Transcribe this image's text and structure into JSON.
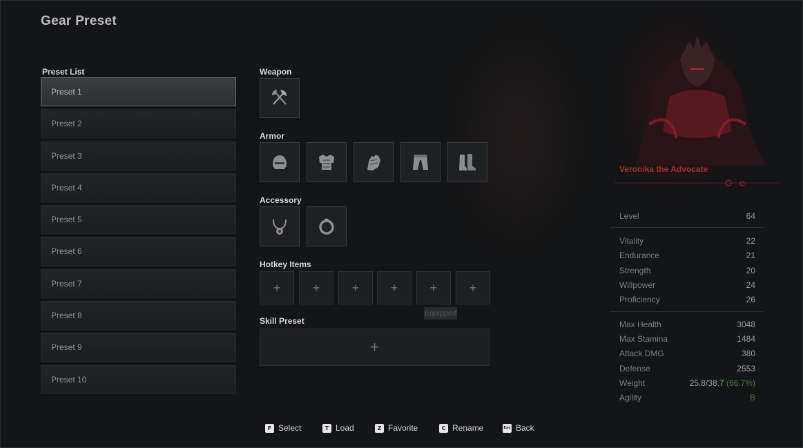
{
  "title": "Gear Preset",
  "preset_list": {
    "label": "Preset List",
    "items": [
      "Preset 1",
      "Preset 2",
      "Preset 3",
      "Preset 4",
      "Preset 5",
      "Preset 6",
      "Preset 7",
      "Preset 8",
      "Preset 9",
      "Preset 10"
    ],
    "selected": "Preset 1"
  },
  "sections": {
    "weapon": "Weapon",
    "armor": "Armor",
    "accessory": "Accessory",
    "hotkey": "Hotkey Items",
    "skill": "Skill Preset"
  },
  "weapon_slots": [
    "axe-weapon-icon"
  ],
  "armor_slots": [
    "helmet-icon",
    "chest-armor-icon",
    "gauntlet-icon",
    "leg-armor-icon",
    "boots-icon"
  ],
  "accessory_slots": [
    "necklace-icon",
    "ring-icon"
  ],
  "hotkey_slot_symbol": "+",
  "skill_slot_symbol": "+",
  "ghost_tooltip": "Equipped",
  "character": {
    "name": "Veronika the Advocate",
    "accent_color": "#b02a2a"
  },
  "stats": {
    "level": {
      "label": "Level",
      "value": "64"
    },
    "attributes": [
      {
        "label": "Vitality",
        "value": "22"
      },
      {
        "label": "Endurance",
        "value": "21"
      },
      {
        "label": "Strength",
        "value": "20"
      },
      {
        "label": "Willpower",
        "value": "24"
      },
      {
        "label": "Proficiency",
        "value": "26"
      }
    ],
    "derived": [
      {
        "label": "Max Health",
        "value": "3048"
      },
      {
        "label": "Max Stamina",
        "value": "1484"
      },
      {
        "label": "Attack DMG",
        "value": "380"
      },
      {
        "label": "Defense",
        "value": "2553"
      }
    ],
    "weight": {
      "label": "Weight",
      "current": "25.8",
      "separator": "/",
      "max": "38.7",
      "percent": "(66.7%)"
    },
    "agility": {
      "label": "Agility",
      "value": "B"
    }
  },
  "footer": [
    {
      "key": "F",
      "label": "Select"
    },
    {
      "key": "T",
      "label": "Load"
    },
    {
      "key": "Z",
      "label": "Favorite"
    },
    {
      "key": "C",
      "label": "Rename"
    },
    {
      "key": "Esc",
      "label": "Back"
    }
  ]
}
